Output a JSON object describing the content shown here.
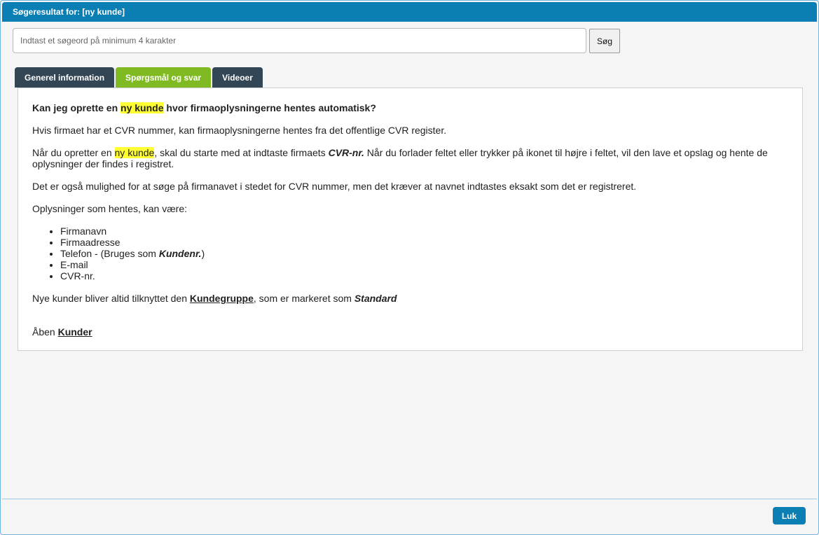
{
  "window": {
    "title": "Søgeresultat for: [ny kunde]"
  },
  "search": {
    "placeholder": "Indtast et søgeord på minimum 4 karakter",
    "value": "",
    "button_label": "Søg"
  },
  "tabs": [
    {
      "label": "Generel information",
      "active": false
    },
    {
      "label": "Spørgsmål og svar",
      "active": true
    },
    {
      "label": "Videoer",
      "active": false
    }
  ],
  "article": {
    "title_before": "Kan jeg oprette en ",
    "title_highlight": "ny kunde",
    "title_after": " hvor firmaoplysningerne hentes automatisk?",
    "p1": "Hvis firmaet har et CVR nummer, kan firmaoplysningerne hentes fra det offentlige CVR register.",
    "p2_before": "Når du opretter en ",
    "p2_highlight": "ny kunde",
    "p2_middle": ", skal du starte med at indtaste firmaets ",
    "p2_emph": "CVR-nr.",
    "p2_after": " Når du forlader feltet eller trykker på ikonet til højre i feltet, vil den lave et opslag og hente de oplysninger der findes i registret.",
    "p3": "Det er også mulighed for at søge på firmanavet i stedet for CVR nummer, men det kræver at navnet indtastes eksakt som det er registreret.",
    "p4": "Oplysninger som hentes, kan være:",
    "list": {
      "item1": "Firmanavn",
      "item2": "Firmaadresse",
      "item3_before": "Telefon - (Bruges som ",
      "item3_emph": "Kundenr.",
      "item3_after": ")",
      "item4": "E-mail",
      "item5": "CVR-nr."
    },
    "p5_before": "Nye kunder bliver altid tilknyttet den ",
    "p5_link": "Kundegruppe",
    "p5_middle": ", som er markeret som ",
    "p5_emph": "Standard",
    "p6_before": "Åben ",
    "p6_link": "Kunder"
  },
  "footer": {
    "close_label": "Luk"
  },
  "colors": {
    "header_blue": "#0b7fb4",
    "tab_active_green": "#7fba23",
    "tab_dark": "#334655",
    "highlight_yellow": "#ffff33"
  }
}
